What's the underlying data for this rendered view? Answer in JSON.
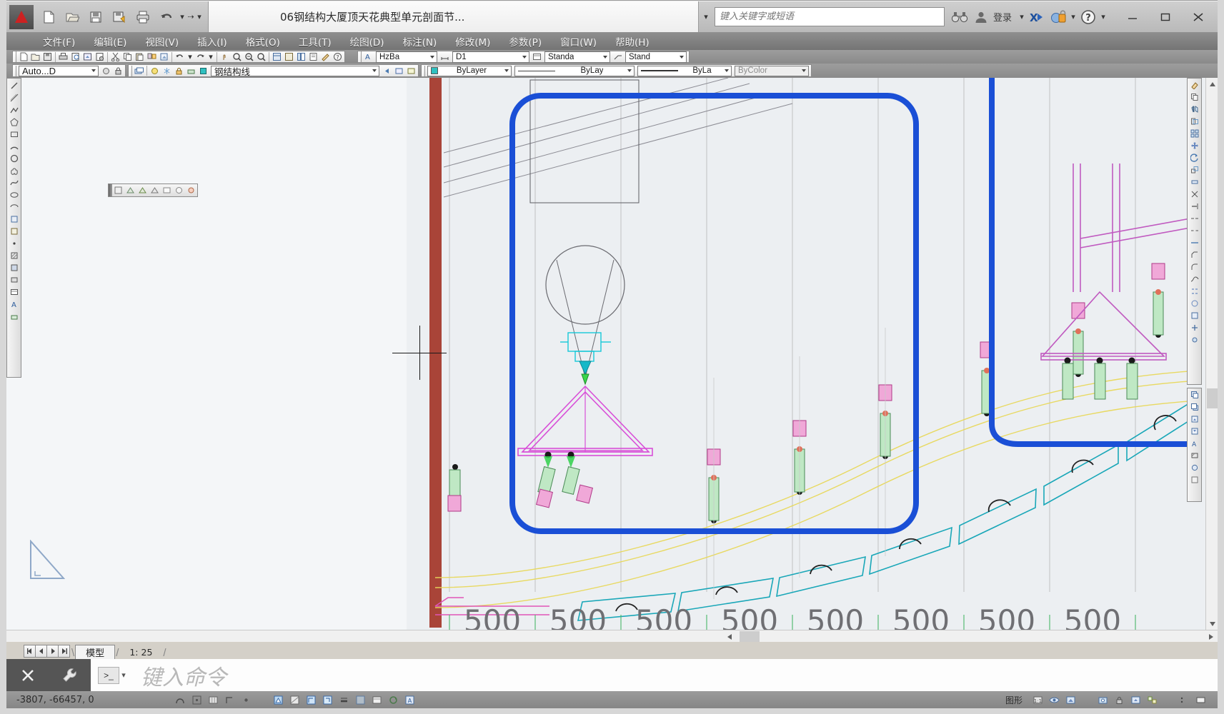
{
  "window": {
    "document_title": "06钢结构大厦顶天花典型单元剖面节...",
    "minimize_label": "最小化",
    "maximize_label": "最大化",
    "close_label": "关闭"
  },
  "quick_access": {
    "app_menu": "应用程序菜单",
    "buttons": [
      {
        "name": "new-file-icon",
        "label": "新建"
      },
      {
        "name": "open-file-icon",
        "label": "打开"
      },
      {
        "name": "save-icon",
        "label": "保存"
      },
      {
        "name": "save-as-icon",
        "label": "另存为"
      },
      {
        "name": "plot-icon",
        "label": "打印"
      },
      {
        "name": "undo-icon",
        "label": "放弃"
      },
      {
        "name": "redo-icon",
        "label": "重做"
      }
    ],
    "overflow_label": "自定义快速访问工具栏"
  },
  "infocenter": {
    "search_placeholder": "键入关键字或短语",
    "search_icon": "binoculars-icon",
    "user_icon": "user-icon",
    "signin_label": "登录",
    "exchange_icon": "exchange-app-icon",
    "security_icon": "security-lock-icon",
    "help_icon": "help-icon"
  },
  "menubar": {
    "items": [
      {
        "label": "文件(F)"
      },
      {
        "label": "编辑(E)"
      },
      {
        "label": "视图(V)"
      },
      {
        "label": "插入(I)"
      },
      {
        "label": "格式(O)"
      },
      {
        "label": "工具(T)"
      },
      {
        "label": "绘图(D)"
      },
      {
        "label": "标注(N)"
      },
      {
        "label": "修改(M)"
      },
      {
        "label": "参数(P)"
      },
      {
        "label": "窗口(W)"
      },
      {
        "label": "帮助(H)"
      }
    ]
  },
  "toolbars": {
    "styles": {
      "text_style": "HzBa",
      "dim_style": "D1",
      "table_style": "Standa",
      "mleader_style": "Stand"
    },
    "layer": {
      "workspace": "Auto...D",
      "current_layer": "钢结构线"
    },
    "properties": {
      "color": "ByLayer",
      "linetype": "ByLay",
      "lineweight": "ByLa",
      "plotstyle": "ByColor"
    }
  },
  "drawing": {
    "dimension_labels": [
      "500",
      "500",
      "500",
      "500",
      "500",
      "500",
      "500",
      "500"
    ],
    "ucs_icon": "ucs-triangle-icon",
    "crosshair": "crosshair-cursor",
    "floating_toolbar": "floating-mini-toolbar"
  },
  "tabs": {
    "first_label": "第一个布局",
    "prev_label": "上一个布局",
    "next_label": "下一个布局",
    "last_label": "最后一个布局",
    "items": [
      {
        "label": "模型",
        "active": true
      },
      {
        "label": "1: 25",
        "active": false
      }
    ]
  },
  "command_line": {
    "close_icon": "close-icon",
    "settings_icon": "wrench-icon",
    "history_badge": ">_",
    "prompt_text": "键入命令"
  },
  "statusbar": {
    "coordinates": "-3807,  -66457,  0",
    "toggles": [
      {
        "name": "status-infer-constraints",
        "label": "推断约束"
      },
      {
        "name": "status-snap",
        "label": "捕捉模式"
      },
      {
        "name": "status-grid",
        "label": "栅格显示"
      },
      {
        "name": "status-ortho",
        "label": "正交模式"
      },
      {
        "name": "status-polar",
        "label": "极轴追踪"
      },
      {
        "name": "status-osnap",
        "label": "对象捕捉"
      },
      {
        "name": "status-otrack",
        "label": "对象捕捉追踪"
      },
      {
        "name": "status-ducs",
        "label": "允许/禁止动态 UCS"
      },
      {
        "name": "status-dyn",
        "label": "动态输入"
      },
      {
        "name": "status-lwt",
        "label": "显示/隐藏线宽"
      },
      {
        "name": "status-transparency",
        "label": "显示/隐藏透明度"
      },
      {
        "name": "status-qp",
        "label": "快捷特性"
      },
      {
        "name": "status-selcycling",
        "label": "选择循环"
      },
      {
        "name": "status-annomon",
        "label": "注释监视器"
      }
    ],
    "right_label": "图形",
    "right_icons": [
      {
        "name": "annotation-scale-icon"
      },
      {
        "name": "annotation-visibility-icon"
      },
      {
        "name": "auto-scale-icon"
      },
      {
        "name": "workspace-switch-icon"
      },
      {
        "name": "toolbar-lock-icon"
      },
      {
        "name": "hardware-accel-icon"
      },
      {
        "name": "isolate-objects-icon"
      },
      {
        "name": "clean-screen-icon"
      }
    ]
  },
  "colors": {
    "accent_blue": "#1a4fd6",
    "titlebar": "#f0f0f0",
    "menubar": "#7e7e7e",
    "canvas": "#eceff2",
    "red_column": "#a94438"
  }
}
